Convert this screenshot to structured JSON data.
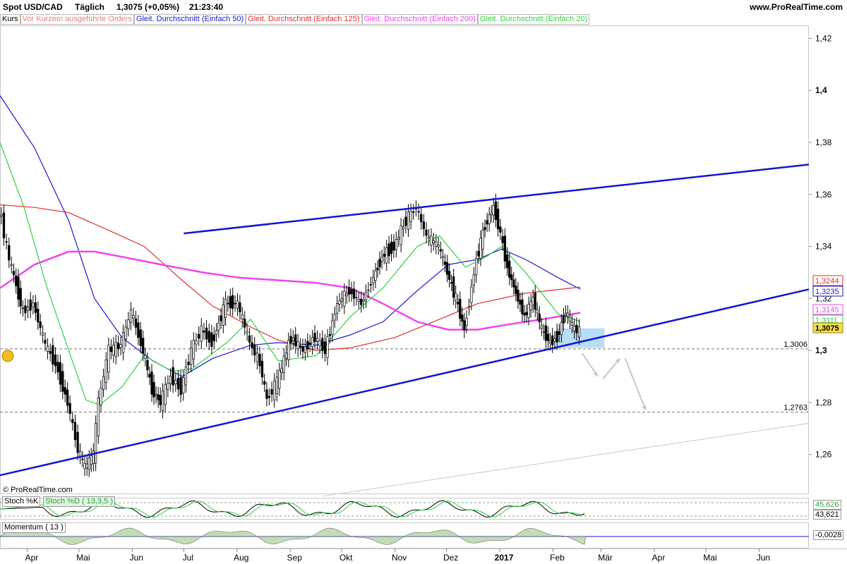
{
  "header": {
    "symbol": "Spot USD/CAD",
    "period": "Täglich",
    "price": "1,3075 (+0,05%)",
    "time": "21:23:40",
    "site": "www.ProRealTime.com"
  },
  "legend": [
    {
      "label": "Kurs",
      "color": "#000000"
    },
    {
      "label": "Vor Kurzem ausgeführte Orders",
      "color": "#e08080"
    },
    {
      "label": "Gleit. Durchschnitt (Einfach 50)",
      "color": "#1a1ad0"
    },
    {
      "label": "Gleit. Durchschnitt (Einfach 125)",
      "color": "#e03030"
    },
    {
      "label": "Gleit. Durchschnitt (Einfach 200)",
      "color": "#ee44ee"
    },
    {
      "label": "Gleit. Durchschnitt (Einfach 20)",
      "color": "#30d040"
    }
  ],
  "copyright": "© ProRealTime.com",
  "colors": {
    "ma50": "#1a1ad0",
    "ma125": "#e03030",
    "ma200": "#ee44ee",
    "ma20": "#30d040",
    "trendline": "#1414d0",
    "bull": "#ffffff",
    "bear": "#000000",
    "zone": "#a8d4f4"
  },
  "chart_data": {
    "type": "candlestick",
    "title": "Spot USD/CAD Täglich",
    "x_ticks": [
      "Apr",
      "Mai",
      "Jun",
      "Jul",
      "Aug",
      "Sep",
      "Okt",
      "Nov",
      "Dez",
      "2017",
      "Feb",
      "Mär",
      "Apr",
      "Mai",
      "Jun"
    ],
    "ylim": [
      1.245,
      1.425
    ],
    "y_ticks": [
      "1,26",
      "1,28",
      "1,3",
      "1,32",
      "1,34",
      "1,36",
      "1,38",
      "1,4",
      "1,42"
    ],
    "last_close": 1.3075,
    "last_close_label": "1,3075",
    "ma_values": [
      {
        "name": "Gleit. Durchschnitt (Einfach 125)",
        "value": 1.3244,
        "label": "1,3244"
      },
      {
        "name": "Gleit. Durchschnitt (Einfach 50)",
        "value": 1.3235,
        "label": "1,3235"
      },
      {
        "name": "Gleit. Durchschnitt (Einfach 200)",
        "value": 1.3145,
        "label": "1,3145"
      },
      {
        "name": "Gleit. Durchschnitt (Einfach 20)",
        "value": 1.3111,
        "label": "1,3111"
      }
    ],
    "horizontal_levels": [
      {
        "value": 1.3006,
        "label": "1,3006"
      },
      {
        "value": 1.2763,
        "label": "1,2763"
      }
    ],
    "price_path": [
      [
        "2016-03-16",
        1.355
      ],
      [
        "2016-03-22",
        1.335
      ],
      [
        "2016-03-30",
        1.315
      ],
      [
        "2016-04-05",
        1.318
      ],
      [
        "2016-04-12",
        1.302
      ],
      [
        "2016-04-18",
        1.295
      ],
      [
        "2016-04-25",
        1.28
      ],
      [
        "2016-05-01",
        1.262
      ],
      [
        "2016-05-05",
        1.255
      ],
      [
        "2016-05-10",
        1.26
      ],
      [
        "2016-05-13",
        1.28
      ],
      [
        "2016-05-19",
        1.3
      ],
      [
        "2016-05-26",
        1.302
      ],
      [
        "2016-06-01",
        1.315
      ],
      [
        "2016-06-08",
        1.3
      ],
      [
        "2016-06-13",
        1.285
      ],
      [
        "2016-06-18",
        1.28
      ],
      [
        "2016-06-24",
        1.29
      ],
      [
        "2016-06-30",
        1.285
      ],
      [
        "2016-07-06",
        1.3
      ],
      [
        "2016-07-12",
        1.308
      ],
      [
        "2016-07-18",
        1.303
      ],
      [
        "2016-07-26",
        1.318
      ],
      [
        "2016-08-02",
        1.318
      ],
      [
        "2016-08-09",
        1.303
      ],
      [
        "2016-08-15",
        1.295
      ],
      [
        "2016-08-19",
        1.281
      ],
      [
        "2016-08-25",
        1.288
      ],
      [
        "2016-09-02",
        1.305
      ],
      [
        "2016-09-09",
        1.3
      ],
      [
        "2016-09-16",
        1.305
      ],
      [
        "2016-09-22",
        1.3
      ],
      [
        "2016-09-29",
        1.318
      ],
      [
        "2016-10-06",
        1.323
      ],
      [
        "2016-10-13",
        1.318
      ],
      [
        "2016-10-20",
        1.328
      ],
      [
        "2016-10-25",
        1.336
      ],
      [
        "2016-11-01",
        1.34
      ],
      [
        "2016-11-08",
        1.35
      ],
      [
        "2016-11-14",
        1.355
      ],
      [
        "2016-11-20",
        1.344
      ],
      [
        "2016-11-27",
        1.34
      ],
      [
        "2016-12-02",
        1.33
      ],
      [
        "2016-12-07",
        1.32
      ],
      [
        "2016-12-12",
        1.308
      ],
      [
        "2016-12-19",
        1.335
      ],
      [
        "2016-12-24",
        1.348
      ],
      [
        "2016-12-29",
        1.355
      ],
      [
        "2017-01-02",
        1.345
      ],
      [
        "2017-01-06",
        1.332
      ],
      [
        "2017-01-11",
        1.322
      ],
      [
        "2017-01-16",
        1.313
      ],
      [
        "2017-01-21",
        1.32
      ],
      [
        "2017-01-26",
        1.308
      ],
      [
        "2017-01-31",
        1.303
      ],
      [
        "2017-02-04",
        1.305
      ],
      [
        "2017-02-09",
        1.315
      ],
      [
        "2017-02-14",
        1.308
      ],
      [
        "2017-02-17",
        1.3075
      ]
    ],
    "moving_averages": [
      {
        "name": "Gleit. Durchschnitt (Einfach 50)",
        "points": [
          [
            "2016-03-16",
            1.398
          ],
          [
            "2016-04-05",
            1.378
          ],
          [
            "2016-04-25",
            1.35
          ],
          [
            "2016-05-10",
            1.32
          ],
          [
            "2016-05-26",
            1.305
          ],
          [
            "2016-06-13",
            1.296
          ],
          [
            "2016-06-30",
            1.29
          ],
          [
            "2016-07-18",
            1.297
          ],
          [
            "2016-08-09",
            1.302
          ],
          [
            "2016-08-25",
            1.303
          ],
          [
            "2016-09-16",
            1.302
          ],
          [
            "2016-10-06",
            1.306
          ],
          [
            "2016-10-25",
            1.311
          ],
          [
            "2016-11-14",
            1.323
          ],
          [
            "2016-12-02",
            1.333
          ],
          [
            "2016-12-19",
            1.335
          ],
          [
            "2017-01-02",
            1.339
          ],
          [
            "2017-01-16",
            1.335
          ],
          [
            "2017-02-04",
            1.328
          ],
          [
            "2017-02-17",
            1.3235
          ]
        ]
      },
      {
        "name": "Gleit. Durchschnitt (Einfach 125)",
        "points": [
          [
            "2016-03-16",
            1.356
          ],
          [
            "2016-04-05",
            1.355
          ],
          [
            "2016-04-25",
            1.353
          ],
          [
            "2016-05-19",
            1.346
          ],
          [
            "2016-06-08",
            1.34
          ],
          [
            "2016-06-30",
            1.327
          ],
          [
            "2016-07-18",
            1.317
          ],
          [
            "2016-08-09",
            1.309
          ],
          [
            "2016-08-25",
            1.304
          ],
          [
            "2016-09-16",
            1.3
          ],
          [
            "2016-10-06",
            1.301
          ],
          [
            "2016-11-01",
            1.305
          ],
          [
            "2016-11-27",
            1.312
          ],
          [
            "2016-12-19",
            1.318
          ],
          [
            "2017-01-16",
            1.322
          ],
          [
            "2017-02-17",
            1.3244
          ]
        ]
      },
      {
        "name": "Gleit. Durchschnitt (Einfach 200)",
        "points": [
          [
            "2016-03-16",
            1.324
          ],
          [
            "2016-04-05",
            1.333
          ],
          [
            "2016-04-25",
            1.338
          ],
          [
            "2016-05-10",
            1.338
          ],
          [
            "2016-05-26",
            1.336
          ],
          [
            "2016-06-18",
            1.333
          ],
          [
            "2016-07-12",
            1.33
          ],
          [
            "2016-08-02",
            1.328
          ],
          [
            "2016-08-25",
            1.327
          ],
          [
            "2016-09-16",
            1.326
          ],
          [
            "2016-10-06",
            1.324
          ],
          [
            "2016-10-25",
            1.318
          ],
          [
            "2016-11-14",
            1.311
          ],
          [
            "2016-12-02",
            1.308
          ],
          [
            "2016-12-19",
            1.308
          ],
          [
            "2017-01-06",
            1.31
          ],
          [
            "2017-01-26",
            1.312
          ],
          [
            "2017-02-17",
            1.3145
          ]
        ]
      },
      {
        "name": "Gleit. Durchschnitt (Einfach 20)",
        "points": [
          [
            "2016-03-16",
            1.38
          ],
          [
            "2016-03-30",
            1.355
          ],
          [
            "2016-04-12",
            1.325
          ],
          [
            "2016-04-25",
            1.3
          ],
          [
            "2016-05-05",
            1.281
          ],
          [
            "2016-05-13",
            1.279
          ],
          [
            "2016-05-26",
            1.286
          ],
          [
            "2016-06-08",
            1.298
          ],
          [
            "2016-06-24",
            1.292
          ],
          [
            "2016-07-06",
            1.293
          ],
          [
            "2016-07-26",
            1.303
          ],
          [
            "2016-08-09",
            1.312
          ],
          [
            "2016-08-25",
            1.296
          ],
          [
            "2016-09-16",
            1.298
          ],
          [
            "2016-10-06",
            1.313
          ],
          [
            "2016-10-25",
            1.324
          ],
          [
            "2016-11-14",
            1.34
          ],
          [
            "2016-11-27",
            1.344
          ],
          [
            "2016-12-12",
            1.332
          ],
          [
            "2016-12-24",
            1.336
          ],
          [
            "2017-01-02",
            1.34
          ],
          [
            "2017-01-16",
            1.33
          ],
          [
            "2017-02-04",
            1.314
          ],
          [
            "2017-02-17",
            1.3111
          ]
        ]
      }
    ],
    "trendlines": [
      {
        "from": [
          "2016-07-01",
          1.345
        ],
        "to": [
          "2017-06-30",
          1.3715
        ]
      },
      {
        "from": [
          "2016-03-16",
          1.252
        ],
        "to": [
          "2017-06-30",
          1.3235
        ]
      }
    ],
    "indicators": [
      {
        "name": "Stoch %K",
        "label": "Stoch %K",
        "value": "43,621"
      },
      {
        "name": "Stoch %D (13,3,5)",
        "label": "Stoch %D ( 13,3,5 )",
        "value": "45,626"
      },
      {
        "name": "Momentum (13)",
        "label": "Momentum ( 13 )",
        "value": "-0,0028"
      }
    ]
  }
}
